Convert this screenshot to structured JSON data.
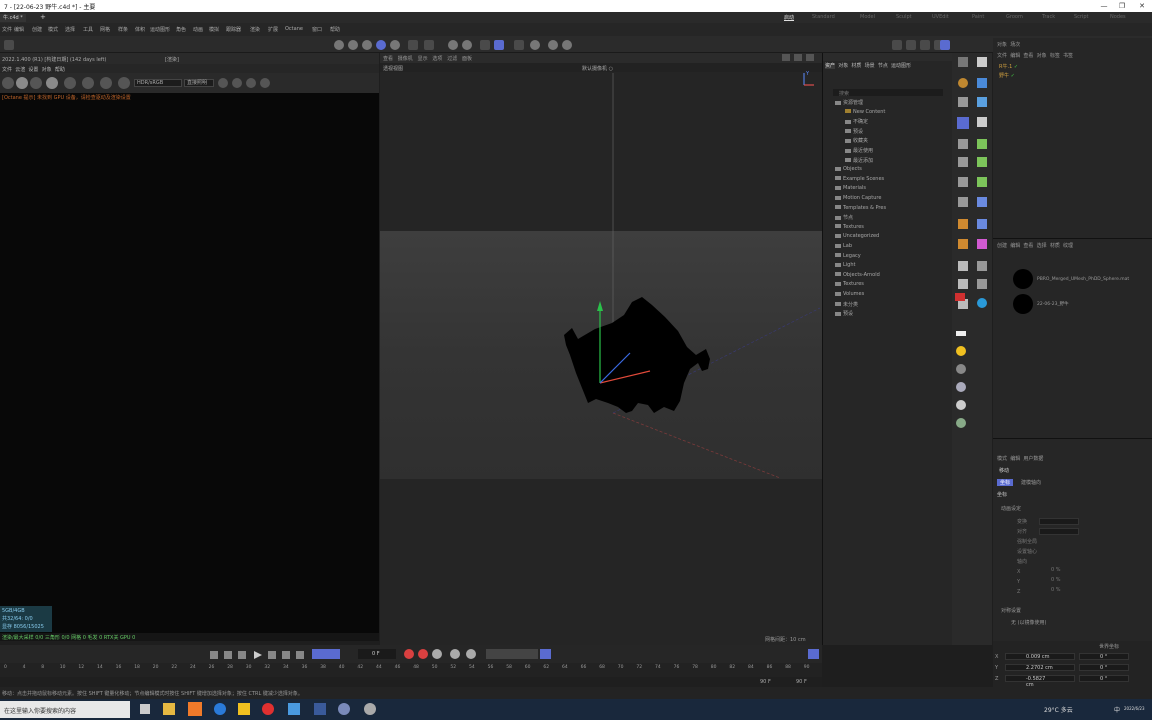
{
  "window": {
    "title": "7 - [22-06-23 野牛.c4d *] - 主要",
    "controls": [
      "—",
      "❐",
      "✕"
    ]
  },
  "tabs": {
    "file_tab": "牛.c4d *",
    "add": "+"
  },
  "layouts": [
    "启动",
    "Standard",
    "Model",
    "Sculpt",
    "UVEdit",
    "Paint",
    "Groom",
    "Track",
    "Script",
    "Nodes"
  ],
  "active_layout": "启动",
  "menu": [
    "文件",
    "编辑",
    "创建",
    "模式",
    "选择",
    "工具",
    "网格",
    "样条",
    "体积",
    "运动图形",
    "角色",
    "动画",
    "模拟",
    "跟踪器",
    "渲染",
    "扩展",
    "Octane",
    "窗口",
    "帮助"
  ],
  "left_panel": {
    "header": "2022.1.400 (R1) [构建日期] (142 days left)",
    "right_label": "[渲染]",
    "menu2": [
      "文件",
      "云渲",
      "设置",
      "对象",
      "帮助"
    ],
    "hdr_mode": "HDR/sRGB",
    "hdr_option": "直接照明",
    "warning": "[Octane 提示] 未找到 GPU 设备，请检查驱动及渲染设置",
    "stats": [
      "5GB/4GB",
      "共32/64: 0/0",
      "显存 8056/15025"
    ],
    "status": "渲染/最大采样 0/0    三角形 0/0    网格 0    毛发 0    RTX关    GPU 0"
  },
  "viewport": {
    "menus": [
      "查看",
      "摄像机",
      "显示",
      "选项",
      "过滤",
      "面板"
    ],
    "camera": "透视视图",
    "title": "默认摄像机 ○",
    "grid": "网格间距：10 cm",
    "axis": "Y"
  },
  "transport": {
    "frame_field": "0 F",
    "end_a": "90 F",
    "end_b": "90 F"
  },
  "timeline_ticks": [
    "0",
    "4",
    "8",
    "10",
    "12",
    "14",
    "16",
    "18",
    "20",
    "22",
    "24",
    "26",
    "28",
    "30",
    "32",
    "34",
    "36",
    "38",
    "40",
    "42",
    "44",
    "46",
    "48",
    "50",
    "52",
    "54",
    "56",
    "58",
    "60",
    "62",
    "64",
    "66",
    "68",
    "70",
    "72",
    "74",
    "76",
    "78",
    "80",
    "82",
    "84",
    "86",
    "88",
    "90"
  ],
  "status_bar": "移动：点击并拖动鼠标移动元素。按住 SHIFT 键量化移动；节点编辑模式时按住 SHIFT 键增加选择对象；按住 CTRL 键减少选择对象。",
  "asset_browser": {
    "tabs": [
      "资产",
      "对象",
      "材质",
      "场景",
      "节点",
      "运动图形"
    ],
    "search": "搜索",
    "items": [
      {
        "label": "资源管理",
        "kind": "g"
      },
      {
        "label": "New Content",
        "kind": "y"
      },
      {
        "label": "不确定",
        "kind": "g"
      },
      {
        "label": "预设",
        "kind": "g"
      },
      {
        "label": "收藏夹",
        "kind": "g"
      },
      {
        "label": "最近使用",
        "kind": "g"
      },
      {
        "label": "最近添加",
        "kind": "g"
      },
      {
        "label": "Objects",
        "kind": "g"
      },
      {
        "label": "Example Scenes",
        "kind": "g"
      },
      {
        "label": "Materials",
        "kind": "g"
      },
      {
        "label": "Motion Capture",
        "kind": "g"
      },
      {
        "label": "Templates & Pres",
        "kind": "g"
      },
      {
        "label": "节点",
        "kind": "g"
      },
      {
        "label": "Textures",
        "kind": "g"
      },
      {
        "label": "Uncategorized",
        "kind": "g"
      },
      {
        "label": "Lab",
        "kind": "g"
      },
      {
        "label": "Legacy",
        "kind": "g"
      },
      {
        "label": "Light",
        "kind": "g"
      },
      {
        "label": "Objects-Arnold",
        "kind": "g"
      },
      {
        "label": "Textures",
        "kind": "g"
      },
      {
        "label": "Volumes",
        "kind": "g"
      },
      {
        "label": "未分类",
        "kind": "g"
      },
      {
        "label": "预设",
        "kind": "g"
      }
    ]
  },
  "objects": {
    "header": [
      "对象",
      "场次"
    ],
    "menus": [
      "文件",
      "编辑",
      "查看",
      "对象",
      "标签",
      "书签"
    ],
    "items": [
      "R牛.1",
      "野牛"
    ]
  },
  "materials": {
    "menus": [
      "创建",
      "编辑",
      "查看",
      "选择",
      "材质",
      "纹理"
    ],
    "items": [
      "PBRO_Merged_UMesh_PhDD_Sphere.mat",
      "22-06-23_野牛"
    ]
  },
  "attributes": {
    "tabs": [
      "模式",
      "编辑",
      "用户数据"
    ],
    "title": "移动",
    "subtabs": [
      "坐标",
      "建模轴向"
    ],
    "section1": "坐标",
    "section2": "动画设定",
    "rows": [
      "变换",
      "对齐",
      "强制全局",
      "设置轴心",
      "轴向",
      "X",
      "Y",
      "Z"
    ],
    "values": [
      "0 %",
      "0 %",
      "0 %"
    ],
    "section3": "对称设置",
    "symmetry": "无 (以镜像使用)"
  },
  "coords": {
    "header": "世界坐标",
    "rows": [
      {
        "axis": "X",
        "pos": "0.009 cm",
        "rot": "0 °"
      },
      {
        "axis": "Y",
        "pos": "2.2702 cm",
        "rot": "0 °"
      },
      {
        "axis": "Z",
        "pos": "-0.5827 cm",
        "rot": "0 °"
      }
    ]
  },
  "taskbar": {
    "search": "在这里输入你要搜索的内容",
    "weather": "29°C 多云",
    "lang": "中",
    "time": "2022/6/23"
  }
}
